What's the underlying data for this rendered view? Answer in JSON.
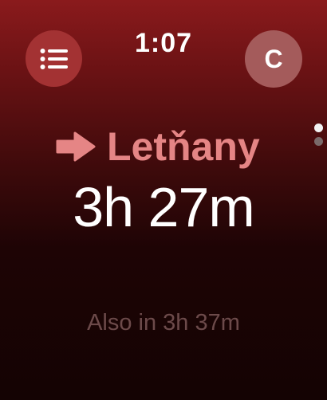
{
  "status_bar": {
    "time": "1:07"
  },
  "menu_button": {
    "icon": "list-icon"
  },
  "account": {
    "initial": "C"
  },
  "pager": {
    "pages": 2,
    "current": 1
  },
  "departure": {
    "direction_icon": "arrow-right-icon",
    "destination": "Letňany",
    "time_until": "3h 27m",
    "also_text": "Also in 3h 37m"
  },
  "colors": {
    "accent": "#e58585",
    "background_top": "#8a1a1c",
    "background_bottom": "#140303",
    "muted_text": "#6c4a4a"
  }
}
